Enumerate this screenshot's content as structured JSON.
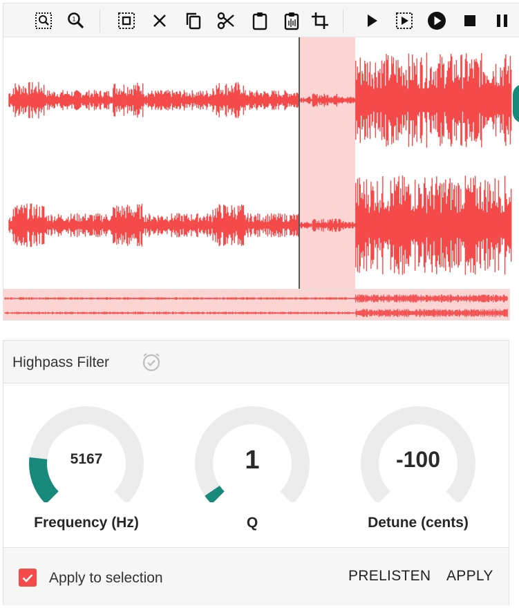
{
  "toolbar": {
    "buttons": [
      {
        "name": "zoom-selection-icon"
      },
      {
        "name": "zoom-reset-icon"
      },
      {
        "name": "select-all-icon"
      },
      {
        "name": "clear-icon"
      },
      {
        "name": "copy-icon"
      },
      {
        "name": "cut-icon"
      },
      {
        "name": "paste-icon"
      },
      {
        "name": "paste-mix-icon"
      },
      {
        "name": "crop-icon"
      },
      {
        "name": "play-icon"
      },
      {
        "name": "play-selection-icon"
      },
      {
        "name": "play-circle-icon"
      },
      {
        "name": "stop-icon"
      },
      {
        "name": "pause-icon"
      }
    ]
  },
  "waveform": {
    "color": "#f44a4a",
    "selection_color": "#fbd4d4",
    "playhead_color": "#555555"
  },
  "effect": {
    "title": "Highpass Filter",
    "title_icon": "timer-check-icon",
    "knobs": [
      {
        "label": "Frequency (Hz)",
        "value": "5167",
        "fill_fraction": 0.19
      },
      {
        "label": "Q",
        "value": "1",
        "fill_fraction": 0.04
      },
      {
        "label": "Detune (cents)",
        "value": "-100",
        "fill_fraction": 0.0
      }
    ],
    "accent": "#188a7c",
    "track": "#ececec"
  },
  "footer": {
    "checkbox_label": "Apply to selection",
    "checked": true,
    "prelisten_label": "PRELISTEN",
    "apply_label": "APPLY"
  }
}
